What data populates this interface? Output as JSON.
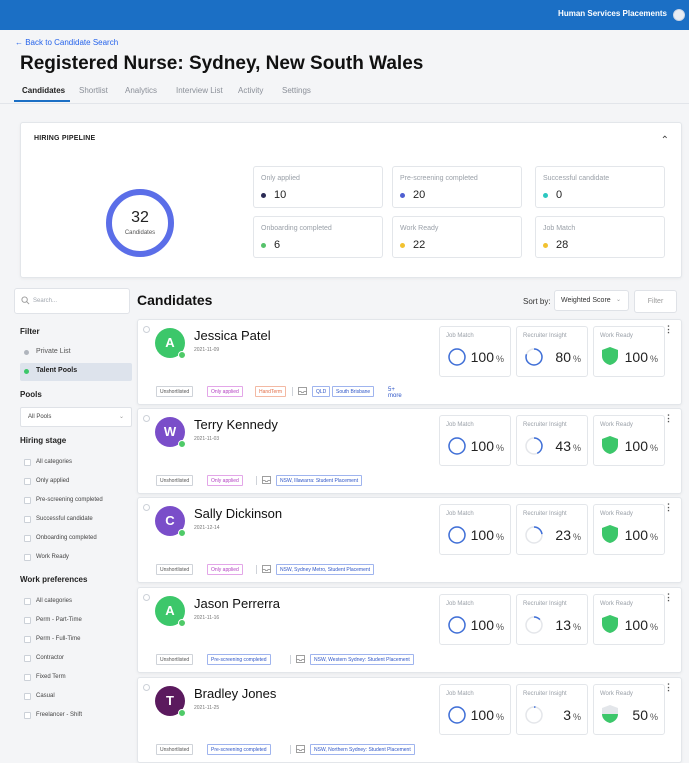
{
  "header": {
    "brand": "Human Services Placements"
  },
  "back_link": "← Back to Candidate Search",
  "page_title": "Registered Nurse: Sydney, New South Wales",
  "tabs": [
    "Candidates",
    "Shortlist",
    "Analytics",
    "Interview List",
    "Activity",
    "Settings"
  ],
  "pipeline": {
    "title": "HIRING PIPELINE",
    "total": "32",
    "total_label": "Candidates",
    "stats": [
      {
        "label": "Only applied",
        "value": "10",
        "color": "#2b2b55"
      },
      {
        "label": "Pre-screening completed",
        "value": "20",
        "color": "#4f5fd1"
      },
      {
        "label": "Successful candidate",
        "value": "0",
        "color": "#2cc7c0"
      },
      {
        "label": "Onboarding completed",
        "value": "6",
        "color": "#56c26b"
      },
      {
        "label": "Work Ready",
        "value": "22",
        "color": "#f2c230"
      },
      {
        "label": "Job Match",
        "value": "28",
        "color": "#f2c230"
      }
    ]
  },
  "sidebar": {
    "search_placeholder": "Search...",
    "filter_heading": "Filter",
    "filter_items": [
      "Private List",
      "Talent Pools"
    ],
    "pools_heading": "Pools",
    "pools_value": "All Pools",
    "hiring_heading": "Hiring stage",
    "hiring_items": [
      "All categories",
      "Only applied",
      "Pre-screening completed",
      "Successful candidate",
      "Onboarding completed",
      "Work Ready"
    ],
    "work_heading": "Work preferences",
    "work_items": [
      "All categories",
      "Perm - Part-Time",
      "Perm - Full-Time",
      "Contractor",
      "Fixed Term",
      "Casual",
      "Freelancer - Shift"
    ]
  },
  "list": {
    "title": "Candidates",
    "sort_label": "Sort by:",
    "sort_value": "Weighted Score",
    "filter_button": "Filter",
    "metric_labels": {
      "job_match": "Job Match",
      "recruiter": "Recruiter Insight",
      "work_ready": "Work Ready"
    },
    "candidates": [
      {
        "initial": "A",
        "avatar_color": "#3cc76a",
        "name": "Jessica Patel",
        "date": "2021-11-09",
        "job_match": "100",
        "recruiter": "80",
        "work_ready": "100",
        "work_ready_fraction": 1.0,
        "tags": [
          "Unshortlisted",
          "Only applied",
          "HandTerm"
        ],
        "locations": [
          "QLD",
          "South Brisbane"
        ],
        "more": "5+ more"
      },
      {
        "initial": "W",
        "avatar_color": "#7a4ec9",
        "name": "Terry Kennedy",
        "date": "2021-11-03",
        "job_match": "100",
        "recruiter": "43",
        "work_ready": "100",
        "work_ready_fraction": 1.0,
        "tags": [
          "Unshortlisted",
          "Only applied"
        ],
        "locations": [
          "NSW, Illawarra: Student Placement"
        ],
        "more": ""
      },
      {
        "initial": "C",
        "avatar_color": "#7a4ec9",
        "name": "Sally Dickinson",
        "date": "2021-12-14",
        "job_match": "100",
        "recruiter": "23",
        "work_ready": "100",
        "work_ready_fraction": 1.0,
        "tags": [
          "Unshortlisted",
          "Only applied"
        ],
        "locations": [
          "NSW, Sydney Metro, Student Placement"
        ],
        "more": ""
      },
      {
        "initial": "A",
        "avatar_color": "#3cc76a",
        "name": "Jason Perrerra",
        "date": "2021-11-16",
        "job_match": "100",
        "recruiter": "13",
        "work_ready": "100",
        "work_ready_fraction": 1.0,
        "tags": [
          "Unshortlisted",
          "Pre-screening completed"
        ],
        "locations": [
          "NSW, Western Sydney: Student Placement"
        ],
        "more": ""
      },
      {
        "initial": "T",
        "avatar_color": "#5b1a5e",
        "name": "Bradley Jones",
        "date": "2021-11-25",
        "job_match": "100",
        "recruiter": "3",
        "work_ready": "50",
        "work_ready_fraction": 0.5,
        "tags": [
          "Unshortlisted",
          "Pre-screening completed"
        ],
        "locations": [
          "NSW, Northern Sydney: Student Placement"
        ],
        "more": ""
      }
    ]
  }
}
